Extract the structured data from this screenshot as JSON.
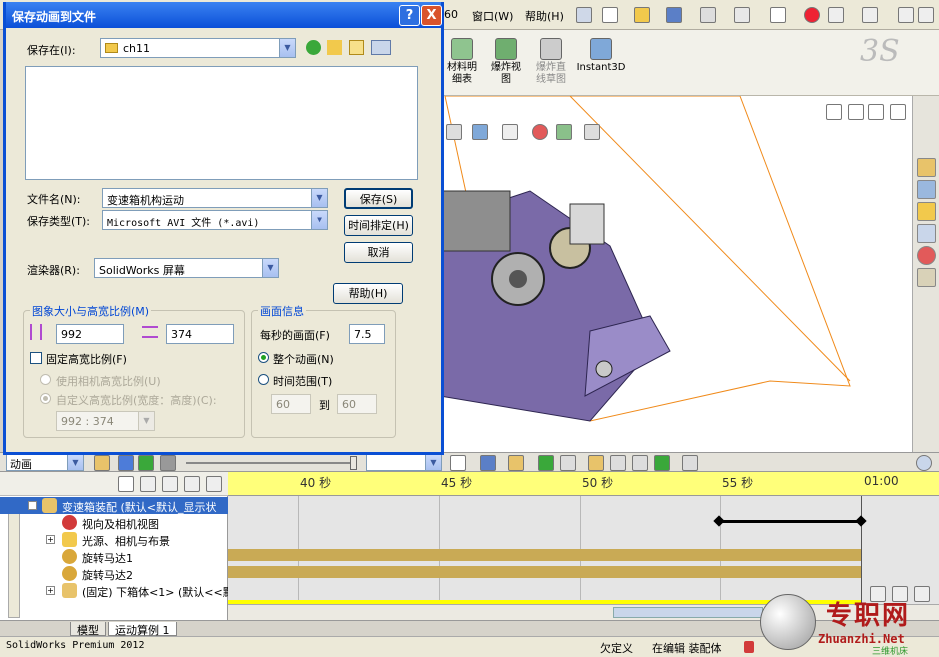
{
  "menubar": {
    "partial_text": "60",
    "window_menu": "窗口(W)",
    "help_menu": "帮助(H)"
  },
  "command_bar": {
    "bom_label": "材料明\n细表",
    "explode_label": "爆炸视\n图",
    "explode_sketch_label": "爆炸直\n线草图",
    "instant3d_label": "Instant3D"
  },
  "dialog": {
    "title": "保存动画到文件",
    "help_caption": "?",
    "close_caption": "X",
    "save_in_label": "保存在(I):",
    "save_in_value": "ch11",
    "filename_label": "文件名(N):",
    "filename_value": "变速箱机构运动",
    "filetype_label": "保存类型(T):",
    "filetype_value": "Microsoft AVI 文件 (*.avi)",
    "renderer_label": "渲染器(R):",
    "renderer_value": "SolidWorks 屏幕",
    "save_button": "保存(S)",
    "schedule_button": "时间排定(H)",
    "cancel_button": "取消",
    "help_button": "帮助(H)",
    "image_size": {
      "group_title": "图象大小与高宽比例(M)",
      "width": "992",
      "height": "374",
      "fixed_aspect_label": "固定高宽比例(F)",
      "use_camera_aspect_label": "使用相机高宽比例(U)",
      "custom_aspect_label": "自定义高宽比例(宽度：高度)(C):",
      "custom_aspect_value": "992 : 374"
    },
    "frame_info": {
      "group_title": "画面信息",
      "fps_label": "每秒的画面(F)",
      "fps_value": "7.5",
      "whole_animation_label": "整个动画(N)",
      "time_range_label": "时间范围(T)",
      "range_from": "60",
      "range_to_label": "到",
      "range_to": "60"
    }
  },
  "motion_manager": {
    "study_type": "动画",
    "timeline_labels": [
      "40 秒",
      "45 秒",
      "50 秒",
      "55 秒",
      "01:00"
    ],
    "tree": [
      {
        "label": "变速箱装配  (默认<默认_显示状",
        "icon": "assembly-icon"
      },
      {
        "label": "视向及相机视图",
        "icon": "camera-icon"
      },
      {
        "label": "光源、相机与布景",
        "icon": "lights-icon"
      },
      {
        "label": "旋转马达1",
        "icon": "motor-icon"
      },
      {
        "label": "旋转马达2",
        "icon": "motor-icon"
      },
      {
        "label": "(固定) 下箱体<1> (默认<<默",
        "icon": "part-icon"
      }
    ],
    "tabs": [
      "模型",
      "运动算例 1"
    ]
  },
  "statusbar": {
    "app_name": "SolidWorks Premium 2012",
    "state1": "欠定义",
    "state2": "在编辑 装配体"
  },
  "watermark": {
    "title": "专职网",
    "url": "Zhuanzhi.Net",
    "subtitle": "三维机床"
  },
  "colors": {
    "dialog_title_blue": "#0b4fd8",
    "timeline_ruler_yellow": "#ffff7a",
    "key_bar_gold": "#c9aa55",
    "model_purple": "#7a6aa8"
  }
}
